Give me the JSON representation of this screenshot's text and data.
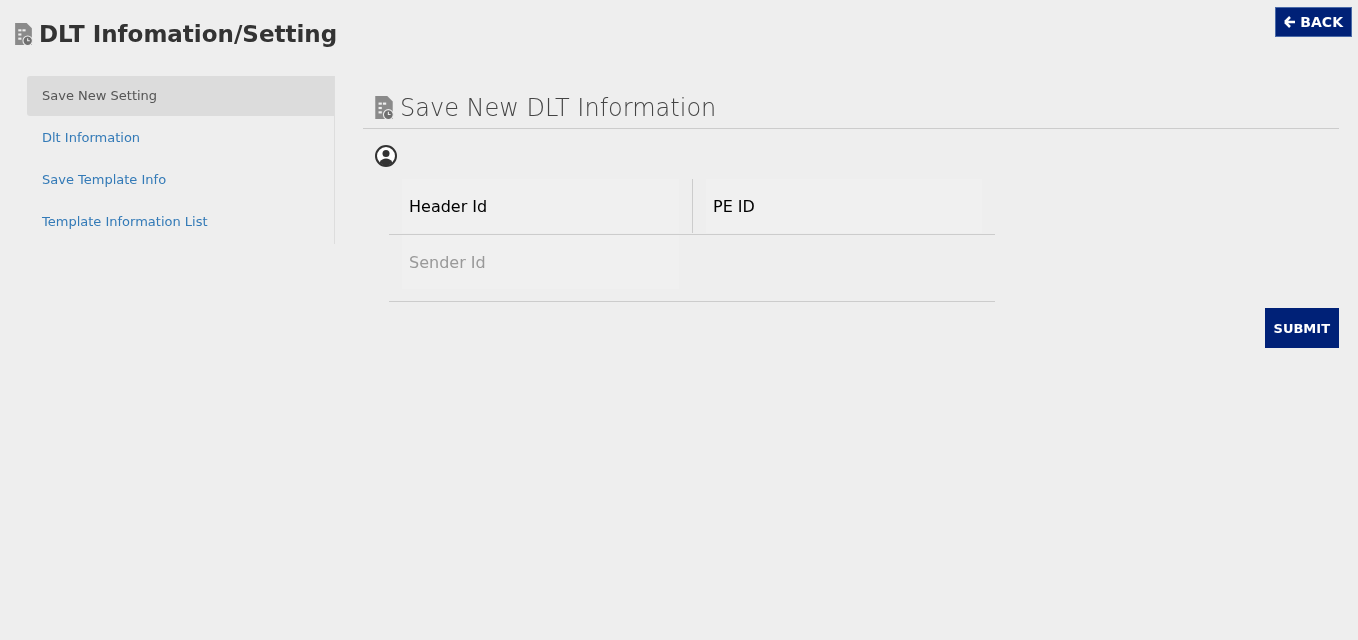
{
  "page": {
    "title": "DLT Infomation/Setting"
  },
  "back_button": {
    "label": "BACK"
  },
  "sidebar": {
    "items": [
      {
        "label": "Save New Setting",
        "selected": true
      },
      {
        "label": "Dlt Information",
        "selected": false
      },
      {
        "label": "Save Template Info",
        "selected": false
      },
      {
        "label": "Template Information List",
        "selected": false
      }
    ]
  },
  "form": {
    "title": "Save New DLT Information",
    "rows": [
      [
        {
          "value": "Header Id"
        },
        {
          "value": "PE ID"
        }
      ],
      [
        {
          "placeholder": "Sender Id"
        }
      ]
    ],
    "submit": "SUBMIT"
  }
}
